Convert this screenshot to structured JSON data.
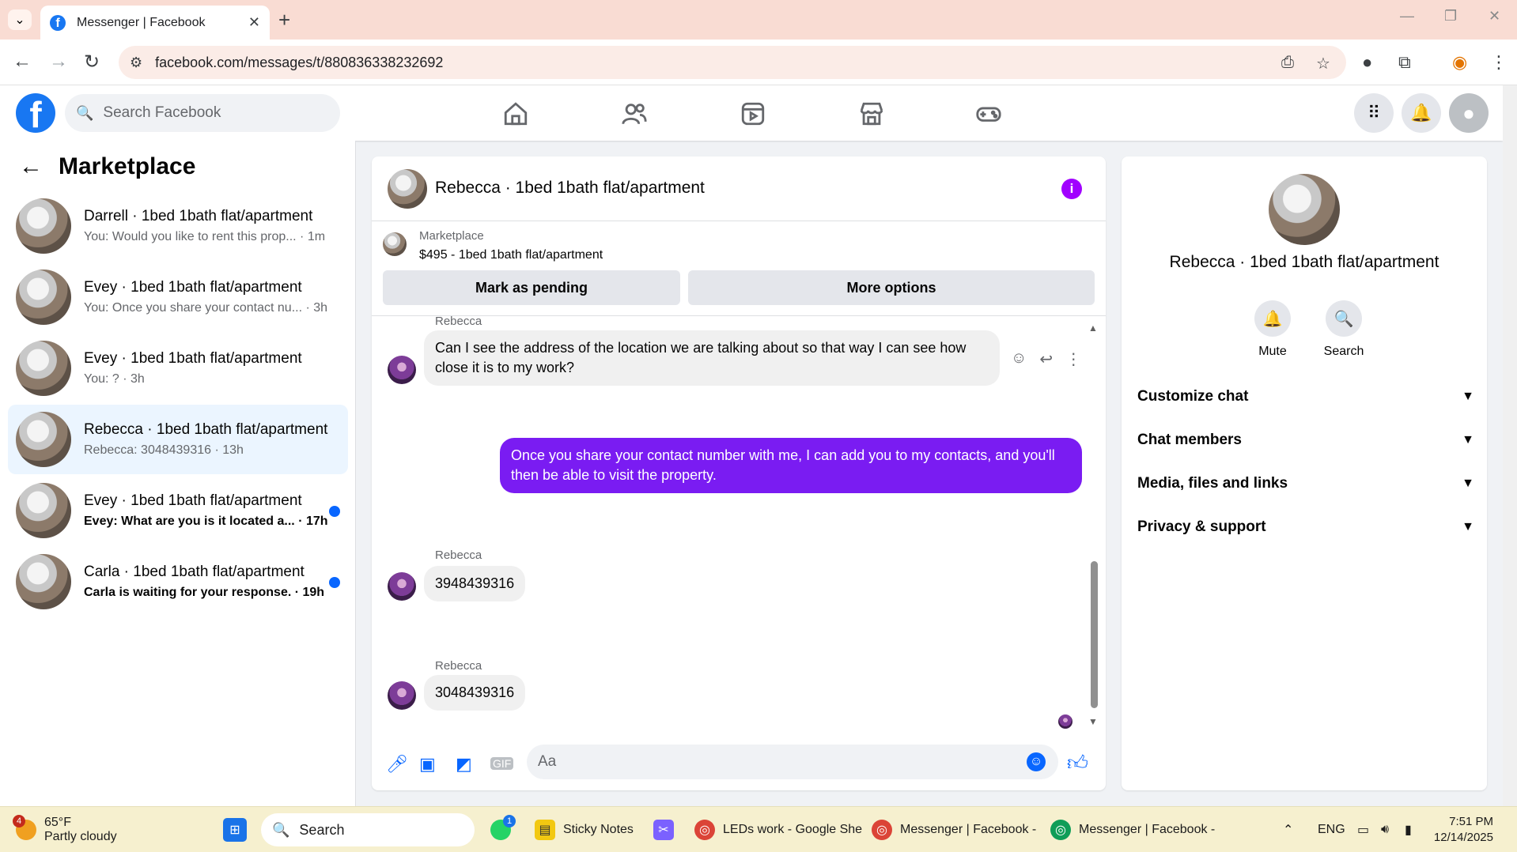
{
  "browser": {
    "tab_title": "Messenger | Facebook",
    "url": "facebook.com/messages/t/880836338232692",
    "favicon_letter": "f"
  },
  "fb": {
    "logo_letter": "f",
    "search_placeholder": "Search Facebook"
  },
  "marketplace": {
    "title": "Marketplace",
    "conversations": [
      {
        "name": "Darrell · 1bed 1bath flat/apartment",
        "snippet": "You: Would you like to rent this prop... · 1m",
        "unread": false,
        "active": false
      },
      {
        "name": "Evey · 1bed 1bath flat/apartment",
        "snippet": "You: Once you share your contact nu... · 3h",
        "unread": false,
        "active": false
      },
      {
        "name": "Evey · 1bed 1bath flat/apartment",
        "snippet": "You: ? · 3h",
        "unread": false,
        "active": false
      },
      {
        "name": "Rebecca · 1bed 1bath flat/apartment",
        "snippet": "Rebecca: 3048439316 · 13h",
        "unread": false,
        "active": true
      },
      {
        "name": "Evey · 1bed 1bath flat/apartment",
        "snippet": "Evey: What are you is it located a... · 17h",
        "unread": true,
        "active": false
      },
      {
        "name": "Carla · 1bed 1bath flat/apartment",
        "snippet": "Carla is waiting for your response. · 19h",
        "unread": true,
        "active": false
      }
    ]
  },
  "chat": {
    "title": "Rebecca · 1bed 1bath flat/apartment",
    "info_icon": "i",
    "listing_label": "Marketplace",
    "listing_price": "$495 - 1bed 1bath flat/apartment",
    "mark_pending": "Mark as pending",
    "more_options": "More options",
    "messages": [
      {
        "sender": "Rebecca",
        "text": "Can I see the address of the location we are talking about so that way I can see how close it is to my work?"
      },
      {
        "sender": "",
        "text": "Once you share your contact number with me, I can add you to my contacts, and you'll then be able to visit the property."
      },
      {
        "sender": "Rebecca",
        "text": "3948439316"
      },
      {
        "sender": "Rebecca",
        "text": "3048439316"
      }
    ],
    "composer_placeholder": "Aa",
    "gif_label": "GIF"
  },
  "info_panel": {
    "name": "Rebecca · 1bed 1bath flat/apartment",
    "mute": "Mute",
    "search": "Search",
    "sections": [
      "Customize chat",
      "Chat members",
      "Media, files and links",
      "Privacy & support"
    ]
  },
  "taskbar": {
    "weather_temp": "65°F",
    "weather_desc": "Partly cloudy",
    "weather_badge": "4",
    "search": "Search",
    "whatsapp_badge": "1",
    "sticky_notes": "Sticky Notes",
    "sheets_window": "LEDs work - Google She",
    "messenger_window_1": "Messenger | Facebook -",
    "messenger_window_2": "Messenger | Facebook -",
    "lang": "ENG",
    "time": "7:51 PM",
    "date": "12/14/2025"
  }
}
